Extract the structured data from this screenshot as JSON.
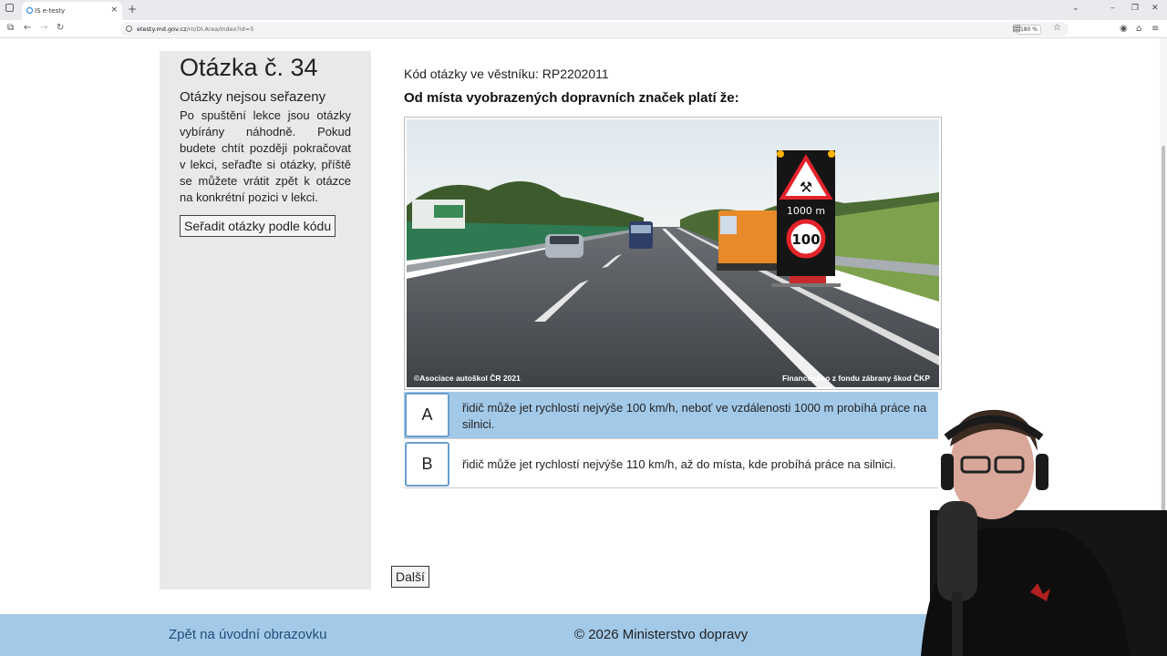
{
  "browser": {
    "tab_title": "IS e-testy",
    "url_host": "etesty.md.gov.cz",
    "url_path": "/ro/DI.Area/Index?id=5",
    "zoom": "180 %"
  },
  "sidebar": {
    "question_number": "Otázka č. 34",
    "sorted_heading": "Otázky nejsou seřazeny",
    "sorted_text": "Po spuštění lekce jsou otázky vybírány náhodně. Pokud budete chtít později pokračovat v lekci, seřaďte si otázky, příště se můžete vrátit zpět k otázce na konkrétní pozici v lekci.",
    "sort_button": "Seřadit otázky podle kódu"
  },
  "main": {
    "code_label": "Kód otázky ve věstníku: RP2202011",
    "question": "Od místa vyobrazených dopravních značek platí že:",
    "image": {
      "caption_left": "©Asociace autoškol ČR 2021",
      "caption_right": "Financováno z fondu zábrany škod ČKP",
      "sign_distance": "1000 m",
      "sign_speed": "100"
    },
    "answers": [
      {
        "letter": "A",
        "text": "řidič může jet rychlostí nejvýše 100 km/h, neboť ve vzdálenosti 1000 m probíhá práce na silnici.",
        "selected": true
      },
      {
        "letter": "B",
        "text": "řidič může jet rychlostí nejvýše 110 km/h, až do místa, kde probíhá práce na silnici.",
        "selected": false
      }
    ],
    "next_button": "Další"
  },
  "footer": {
    "back_link": "Zpět na úvodní obrazovku",
    "copyright": "© 2026 Ministerstvo dopravy"
  },
  "colors": {
    "selected_answer": "#a3c9e8",
    "footer": "#a3c9e8",
    "sidebar": "#e9e9e9"
  }
}
